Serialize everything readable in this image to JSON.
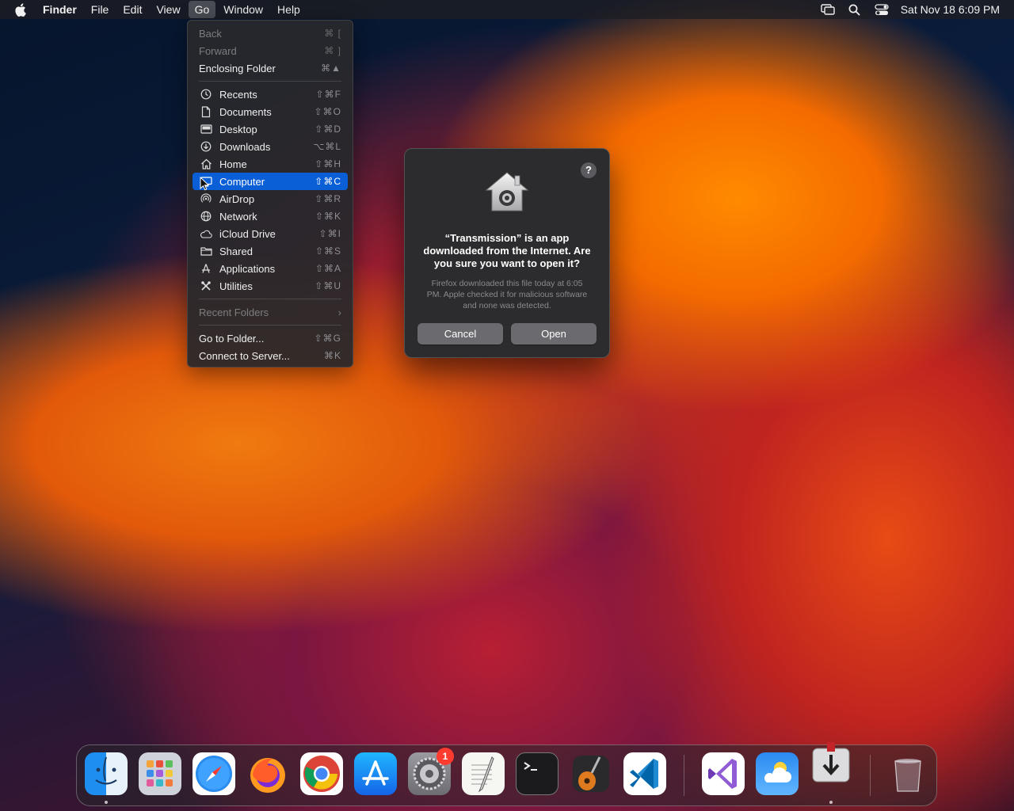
{
  "menubar": {
    "app_name": "Finder",
    "items": [
      "File",
      "Edit",
      "View",
      "Go",
      "Window",
      "Help"
    ],
    "clock": "Sat Nov 18  6:09 PM"
  },
  "go_menu": {
    "back": {
      "label": "Back",
      "shortcut": "⌘ ["
    },
    "forward": {
      "label": "Forward",
      "shortcut": "⌘ ]"
    },
    "enclosing": {
      "label": "Enclosing Folder",
      "shortcut": "⌘▲"
    },
    "places": [
      {
        "label": "Recents",
        "shortcut": "⇧⌘F",
        "icon": "clock-icon"
      },
      {
        "label": "Documents",
        "shortcut": "⇧⌘O",
        "icon": "document-icon"
      },
      {
        "label": "Desktop",
        "shortcut": "⇧⌘D",
        "icon": "desktop-icon"
      },
      {
        "label": "Downloads",
        "shortcut": "⌥⌘L",
        "icon": "download-icon"
      },
      {
        "label": "Home",
        "shortcut": "⇧⌘H",
        "icon": "home-icon"
      },
      {
        "label": "Computer",
        "shortcut": "⇧⌘C",
        "icon": "computer-icon"
      },
      {
        "label": "AirDrop",
        "shortcut": "⇧⌘R",
        "icon": "airdrop-icon"
      },
      {
        "label": "Network",
        "shortcut": "⇧⌘K",
        "icon": "globe-icon"
      },
      {
        "label": "iCloud Drive",
        "shortcut": "⇧⌘I",
        "icon": "cloud-icon"
      },
      {
        "label": "Shared",
        "shortcut": "⇧⌘S",
        "icon": "shared-folder-icon"
      },
      {
        "label": "Applications",
        "shortcut": "⇧⌘A",
        "icon": "applications-icon"
      },
      {
        "label": "Utilities",
        "shortcut": "⇧⌘U",
        "icon": "utilities-icon"
      }
    ],
    "recent_folders": "Recent Folders",
    "go_to_folder": {
      "label": "Go to Folder...",
      "shortcut": "⇧⌘G"
    },
    "connect_server": {
      "label": "Connect to Server...",
      "shortcut": "⌘K"
    }
  },
  "dialog": {
    "title": "“Transmission” is an app downloaded from the Internet. Are you sure you want to open it?",
    "body": "Firefox downloaded this file today at 6:05 PM. Apple checked it for malicious software and none was detected.",
    "cancel": "Cancel",
    "open": "Open",
    "help": "?"
  },
  "dock": {
    "settings_badge": "1",
    "apps": [
      "Finder",
      "Launchpad",
      "Safari",
      "Firefox",
      "Chrome",
      "App Store",
      "System Settings",
      "TextEdit",
      "Terminal",
      "GarageBand",
      "Visual Studio Code",
      "Visual Studio",
      "Weather",
      "Transmission",
      "Trash"
    ]
  }
}
